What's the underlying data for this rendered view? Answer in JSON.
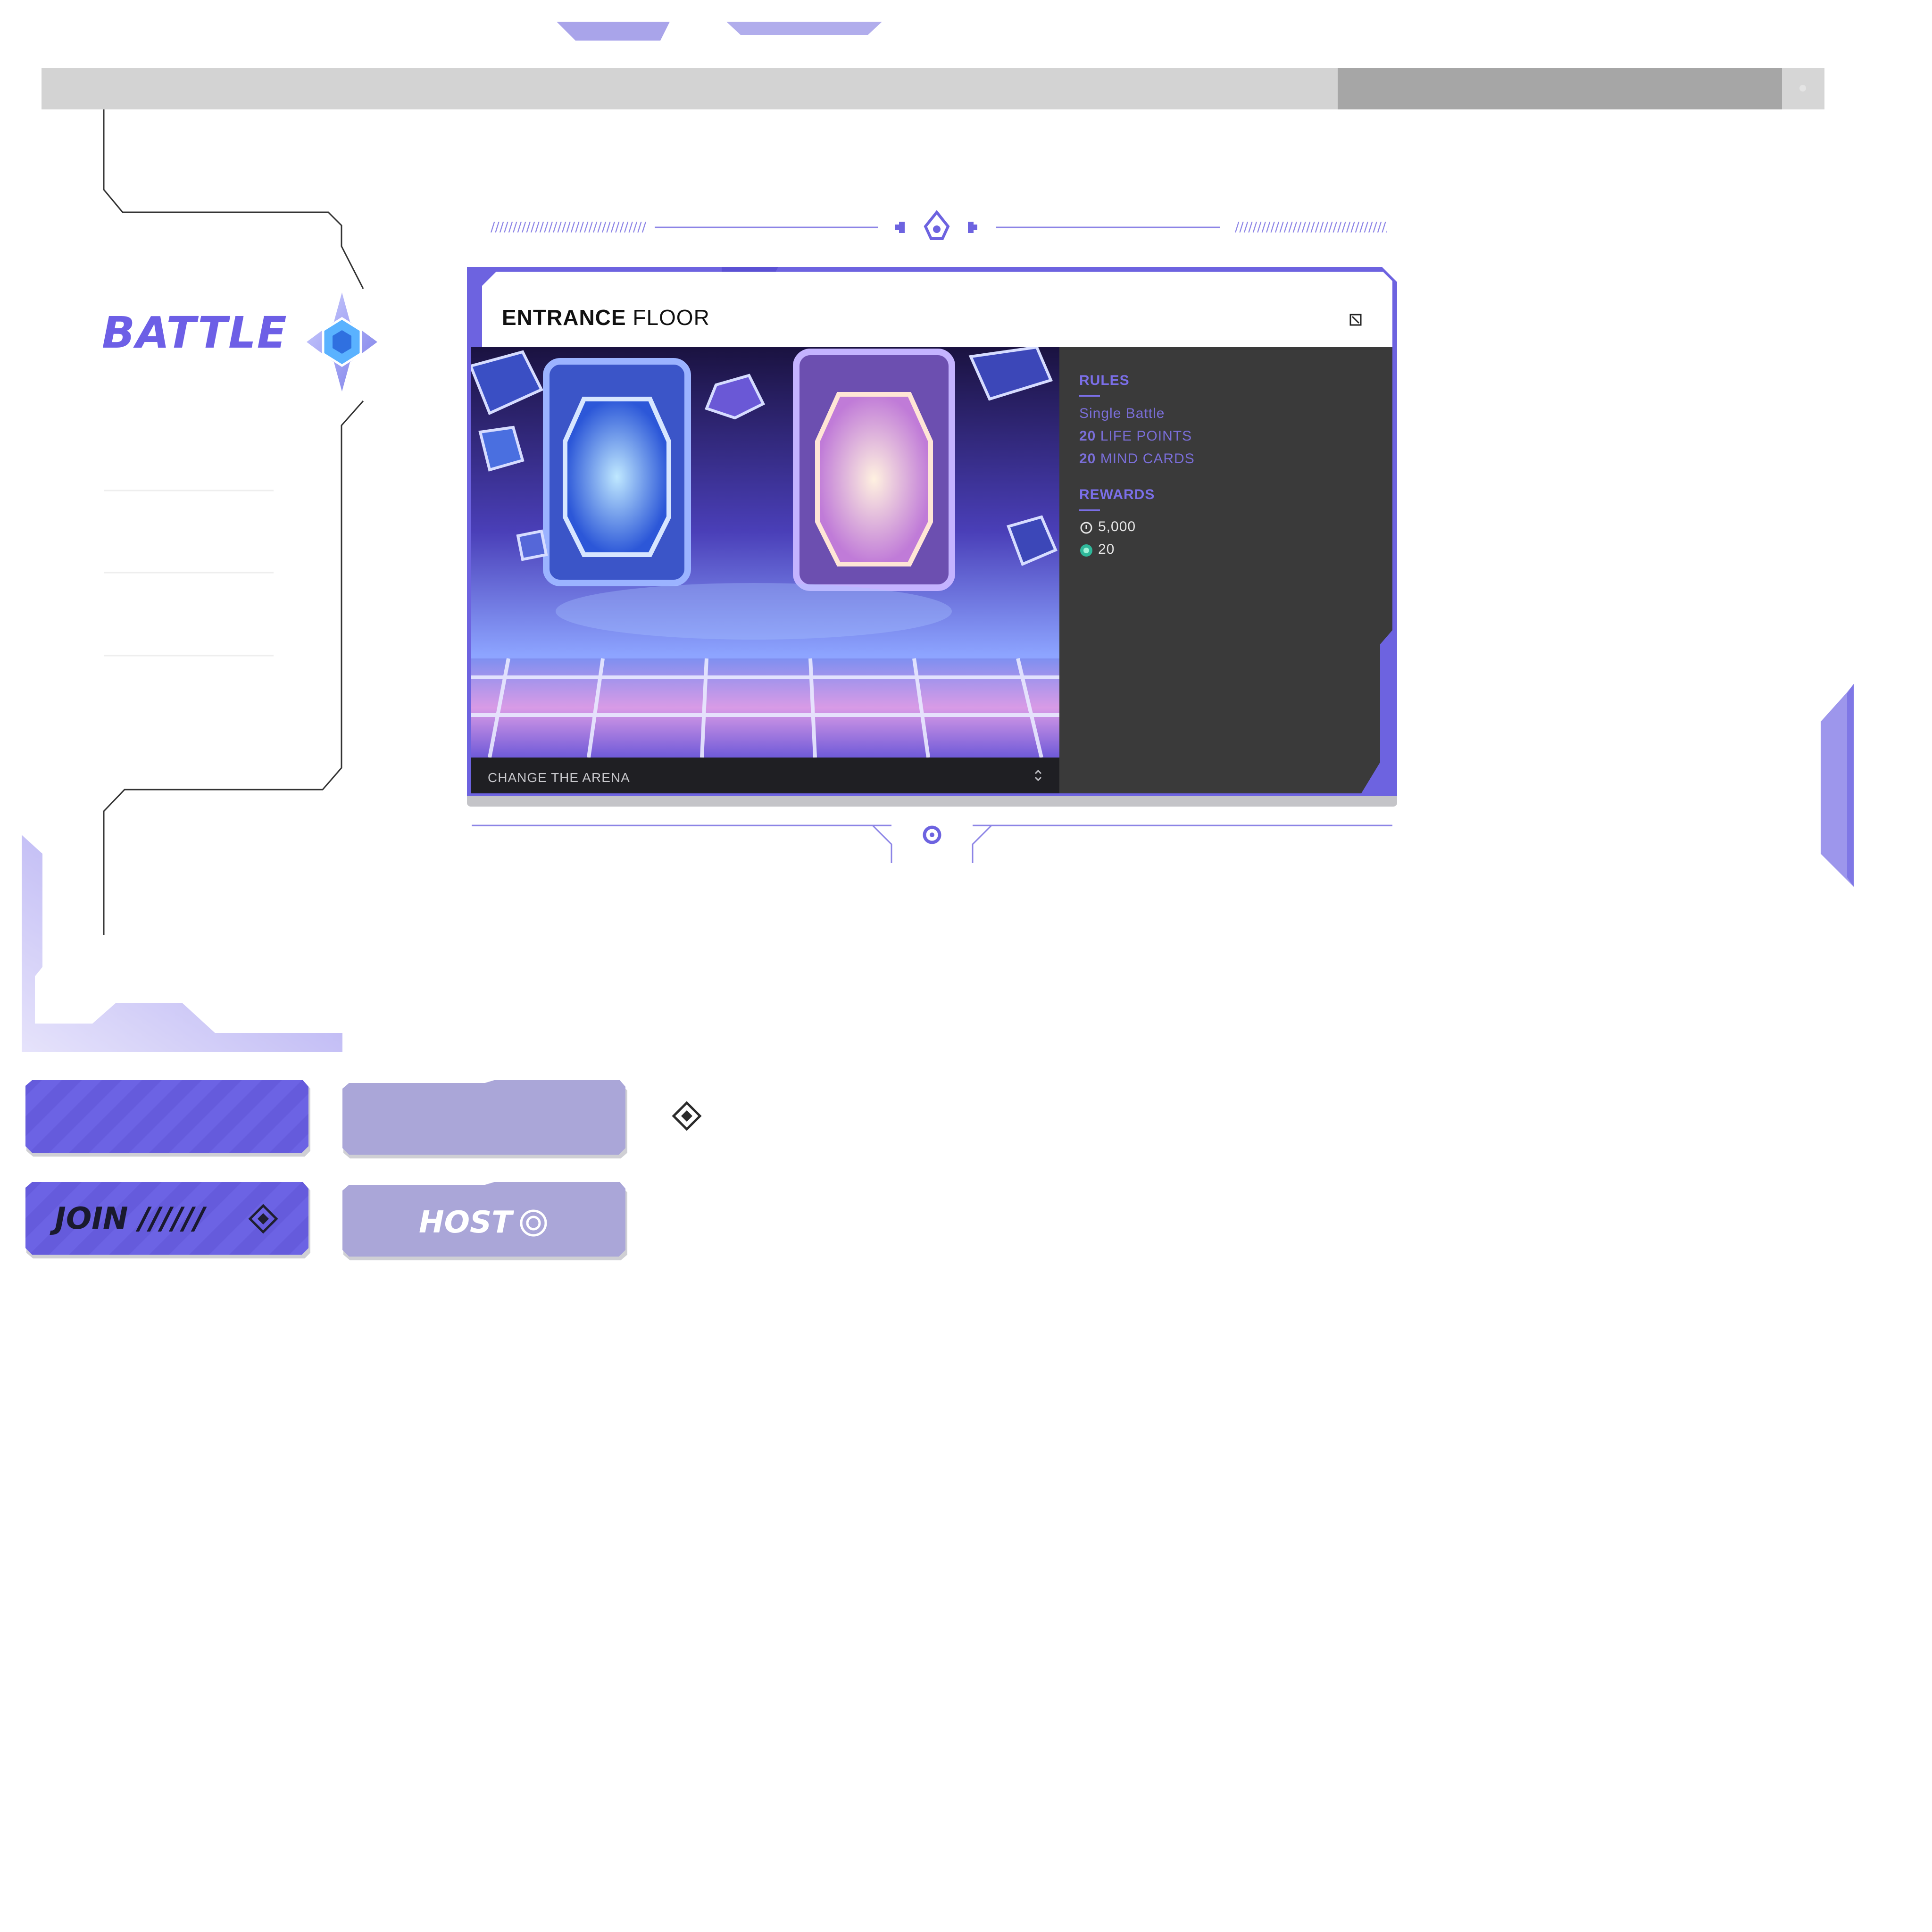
{
  "colors": {
    "accent": "#6d63e0",
    "accent_light": "#a9a5d4",
    "panel_dark": "#3a3a3a",
    "header_bar": "#d3d3d3"
  },
  "mode": {
    "title": "BATTLE",
    "emblem_icon": "crystal-cube-icon"
  },
  "arena": {
    "title_bold": "ENTRANCE",
    "title_rest": "FLOOR",
    "expand_icon": "expand-icon",
    "change_label": "CHANGE THE ARENA",
    "change_icon": "up-down-chevron-icon"
  },
  "rules": {
    "heading": "RULES",
    "mode": "Single Battle",
    "life_points_value": "20",
    "life_points_label": "LIFE POINTS",
    "mind_cards_value": "20",
    "mind_cards_label": "MIND CARDS"
  },
  "rewards": {
    "heading": "REWARDS",
    "items": [
      {
        "icon": "coin-icon",
        "amount": "5,000"
      },
      {
        "icon": "gem-icon",
        "amount": "20"
      }
    ]
  },
  "buttons": {
    "join_label": "JOIN //////",
    "join_icon": "diamond-target-icon",
    "host_label": "HOST",
    "host_icon": "target-ring-icon"
  }
}
